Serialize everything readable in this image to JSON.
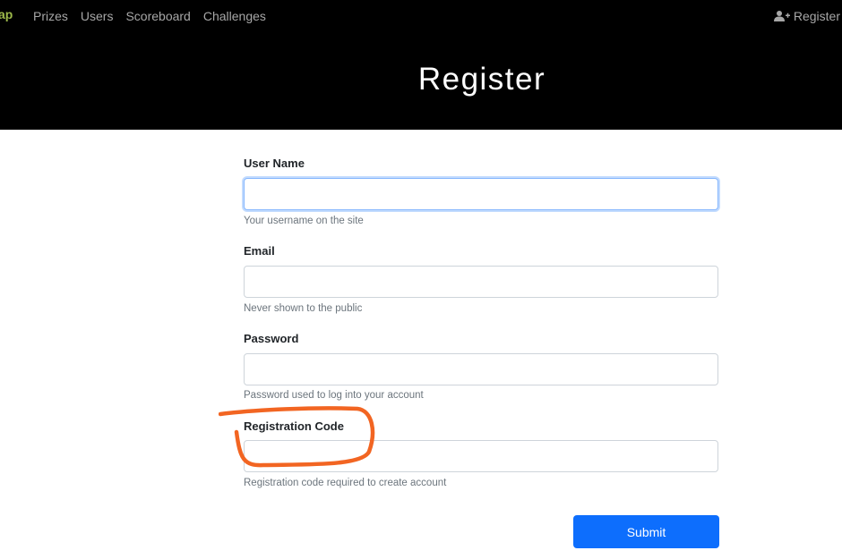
{
  "nav": {
    "brand": "ap",
    "items": [
      "Prizes",
      "Users",
      "Scoreboard",
      "Challenges"
    ],
    "register": "Register",
    "register_icon": "user-plus-icon"
  },
  "page": {
    "title": "Register"
  },
  "form": {
    "fields": [
      {
        "label": "User Name",
        "help": "Your username on the site",
        "value": "",
        "focused": true
      },
      {
        "label": "Email",
        "help": "Never shown to the public",
        "value": ""
      },
      {
        "label": "Password",
        "help": "Password used to log into your account",
        "value": ""
      },
      {
        "label": "Registration Code",
        "help": "Registration code required to create account",
        "value": ""
      }
    ],
    "submit": "Submit"
  },
  "colors": {
    "header_bg": "#000000",
    "brand": "#9cb84a",
    "nav_text": "#a7a7a7",
    "primary": "#0d6efd",
    "annotation": "#f26522"
  }
}
